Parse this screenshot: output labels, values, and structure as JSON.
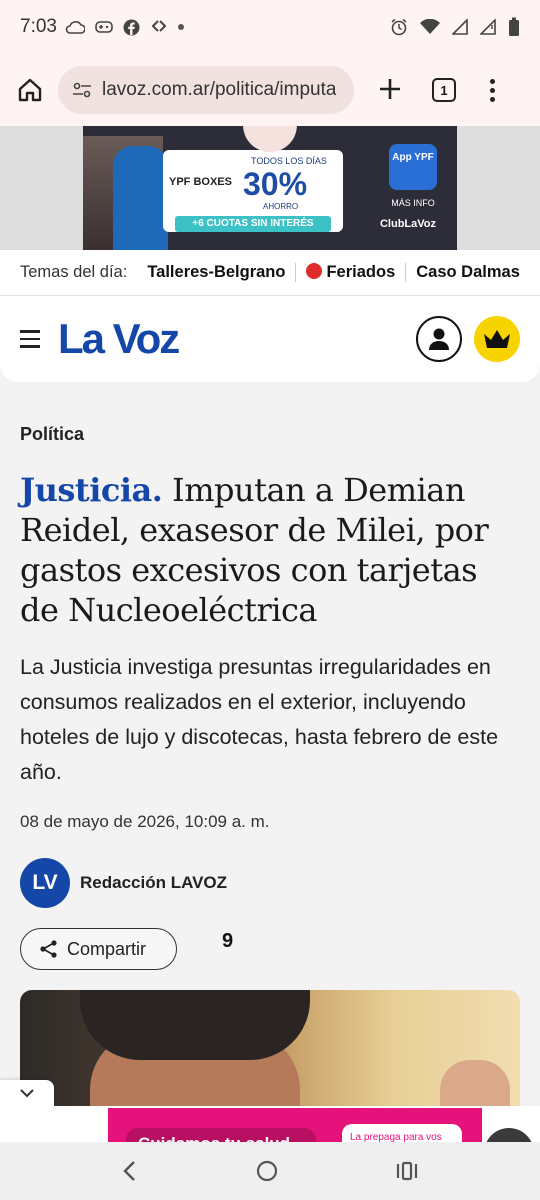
{
  "status_bar": {
    "time": "7:03",
    "left_icons": [
      "cloud-icon",
      "gamepad-icon",
      "facebook-icon",
      "carrefour-icon",
      "dot-icon"
    ],
    "right_icons": [
      "alarm-icon",
      "wifi-icon",
      "signal-icon",
      "signal-icon",
      "battery-icon"
    ]
  },
  "browser": {
    "url": "lavoz.com.ar/politica/imputa",
    "tab_count": "1"
  },
  "ad_top": {
    "boxes": "YPF BOXES",
    "todos_los_dias": "TODOS LOS DÍAS",
    "percent": "30%",
    "ahorro": "AHORRO",
    "cuotas": "+6 CUOTAS SIN INTERÉS",
    "app": "App YPF",
    "mas_info": "MÁS INFO",
    "club": "ClubLaVoz"
  },
  "topics": {
    "label": "Temas del día:",
    "items": [
      "Talleres-Belgrano",
      "Feriados",
      "Caso Dalmas"
    ]
  },
  "header": {
    "logo": "La Voz"
  },
  "article": {
    "section": "Política",
    "kicker": "Justicia.",
    "title": " Imputan a Demian Reidel, exasesor de Milei, por gastos excesivos con tarjetas de Nucleoeléctrica",
    "summary": "La Justicia investiga presuntas irregularidades en consumos realizados en el exterior, incluyendo hoteles de lujo y discotecas, hasta febrero de este año.",
    "date": "08 de mayo de 2026, 10:09 a. m.",
    "author_initials": "LV",
    "author": "Redacción LAVOZ",
    "share_label": "Compartir",
    "comments_count": "9"
  },
  "ad_bottom": {
    "text1": "Cuidamos tu salud",
    "text2": "La prepaga para vos"
  },
  "colors": {
    "brand_blue": "#1547a8",
    "crown_yellow": "#f7d400",
    "ad_pink": "#e6127c"
  }
}
